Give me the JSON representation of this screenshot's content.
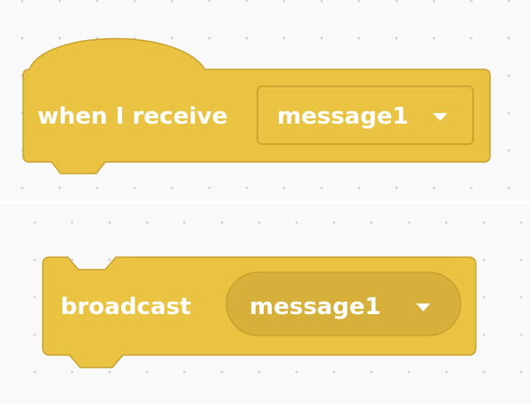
{
  "colors": {
    "block_fill": "#EBC343",
    "block_stroke": "#C9A22D",
    "dropdown_fill": "#D6B03A",
    "canvas_background": "#F9F9F9",
    "grid_dot": "#CFCFCF",
    "text": "#FFFFFF"
  },
  "when_receive_block": {
    "label": "when I receive",
    "dropdown_value": "message1",
    "dropdown_icon": "caret-down-icon"
  },
  "broadcast_block": {
    "label": "broadcast",
    "dropdown_value": "message1",
    "dropdown_icon": "caret-down-icon"
  }
}
